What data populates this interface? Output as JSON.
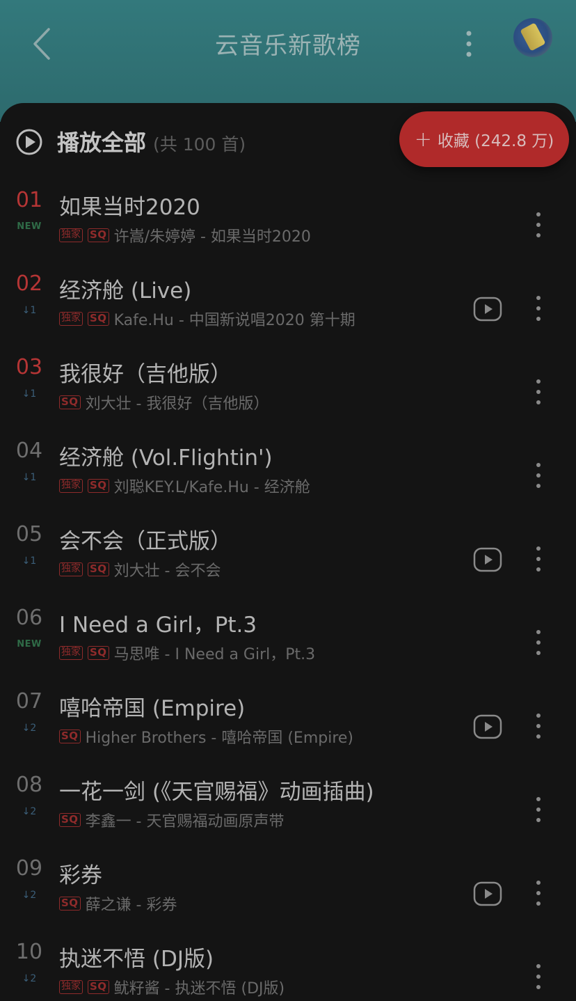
{
  "header": {
    "title": "云音乐新歌榜"
  },
  "play_all": {
    "label": "播放全部",
    "count": "(共 100 首)",
    "collect_label": "收藏 (242.8 万)"
  },
  "songs": [
    {
      "rank": "01",
      "trend": "NEW",
      "title": "如果当时2020",
      "tags": [
        "独家",
        "SQ"
      ],
      "sub": "许嵩/朱婷婷 - 如果当时2020",
      "has_mv": false
    },
    {
      "rank": "02",
      "trend": "↓1",
      "title": "经济舱 (Live)",
      "tags": [
        "独家",
        "SQ"
      ],
      "sub": "Kafe.Hu - 中国新说唱2020 第十期",
      "has_mv": true
    },
    {
      "rank": "03",
      "trend": "↓1",
      "title": "我很好（吉他版）",
      "tags": [
        "SQ"
      ],
      "sub": "刘大壮 - 我很好（吉他版）",
      "has_mv": false
    },
    {
      "rank": "04",
      "trend": "↓1",
      "title": "经济舱 (Vol.Flightin')",
      "tags": [
        "独家",
        "SQ"
      ],
      "sub": "刘聪KEY.L/Kafe.Hu - 经济舱",
      "has_mv": false
    },
    {
      "rank": "05",
      "trend": "↓1",
      "title": "会不会（正式版）",
      "tags": [
        "独家",
        "SQ"
      ],
      "sub": "刘大壮 - 会不会",
      "has_mv": true
    },
    {
      "rank": "06",
      "trend": "NEW",
      "title": "I Need a Girl，Pt.3",
      "tags": [
        "独家",
        "SQ"
      ],
      "sub": "马思唯 - I Need a Girl，Pt.3",
      "has_mv": false
    },
    {
      "rank": "07",
      "trend": "↓2",
      "title": "嘻哈帝国 (Empire)",
      "tags": [
        "SQ"
      ],
      "sub": "Higher Brothers - 嘻哈帝国 (Empire)",
      "has_mv": true
    },
    {
      "rank": "08",
      "trend": "↓2",
      "title": "一花一剑 (《天官赐福》动画插曲)",
      "tags": [
        "SQ"
      ],
      "sub": "李鑫一 - 天官赐福动画原声带",
      "has_mv": false
    },
    {
      "rank": "09",
      "trend": "↓2",
      "title": "彩券",
      "tags": [
        "SQ"
      ],
      "sub": "薛之谦 - 彩券",
      "has_mv": true
    },
    {
      "rank": "10",
      "trend": "↓2",
      "title": "执迷不悟 (DJ版)",
      "tags": [
        "独家",
        "SQ"
      ],
      "sub": "鱿籽酱 - 执迷不悟 (DJ版)",
      "has_mv": false
    }
  ],
  "colors": {
    "header_bg": "#2f6f72",
    "accent_red": "#b02a2a",
    "rank_top": "#b53535",
    "panel_bg": "#141414"
  },
  "icons": {
    "back": "chevron-left-icon",
    "header_more": "vertical-dots-icon",
    "play_all": "play-circle-icon",
    "collect": "plus-icon",
    "mv": "video-play-icon",
    "row_more": "vertical-dots-icon"
  }
}
